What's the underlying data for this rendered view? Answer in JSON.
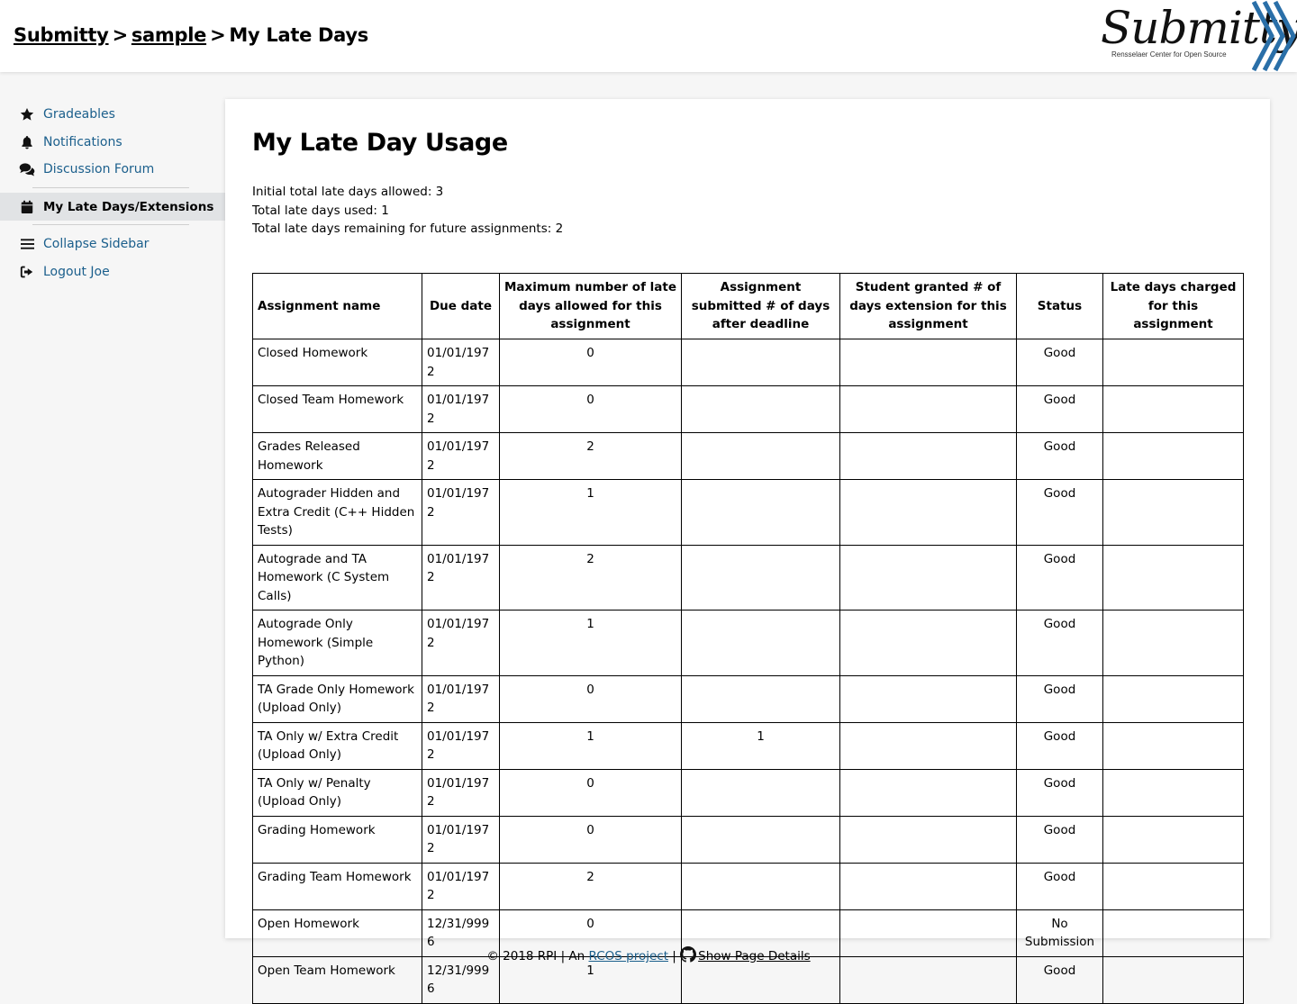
{
  "breadcrumb": {
    "home": "Submitty",
    "course": "sample",
    "page": "My Late Days",
    "separator": ">"
  },
  "logo": {
    "text": "Submitty",
    "subtitle": "Rensselaer Center for Open Source",
    "accent_color": "#2a6fa8"
  },
  "sidebar": {
    "items": [
      {
        "label": "Gradeables",
        "icon": "star-icon"
      },
      {
        "label": "Notifications",
        "icon": "bell-icon"
      },
      {
        "label": "Discussion Forum",
        "icon": "comments-icon"
      },
      {
        "label": "My Late Days/Extensions",
        "icon": "calendar-icon",
        "active": true
      },
      {
        "label": "Collapse Sidebar",
        "icon": "bars-icon"
      },
      {
        "label": "Logout Joe",
        "icon": "sign-out-icon"
      }
    ]
  },
  "main": {
    "title": "My Late Day Usage",
    "summary": {
      "allowed": "Initial total late days allowed: 3",
      "used": "Total late days used: 1",
      "remaining": "Total late days remaining for future assignments: 2"
    },
    "table": {
      "headers": [
        "Assignment name",
        "Due date",
        "Maximum number of late days allowed for this assignment",
        "Assignment submitted # of days after deadline",
        "Student granted # of days extension for this assignment",
        "Status",
        "Late days charged for this assignment"
      ],
      "rows": [
        {
          "name": "Closed Homework",
          "due": "01/01/1972",
          "max": "0",
          "submitted": "",
          "extension": "",
          "status": "Good",
          "charged": ""
        },
        {
          "name": "Closed Team Homework",
          "due": "01/01/1972",
          "max": "0",
          "submitted": "",
          "extension": "",
          "status": "Good",
          "charged": ""
        },
        {
          "name": "Grades Released Homework",
          "due": "01/01/1972",
          "max": "2",
          "submitted": "",
          "extension": "",
          "status": "Good",
          "charged": ""
        },
        {
          "name": "Autograder Hidden and Extra Credit (C++ Hidden Tests)",
          "due": "01/01/1972",
          "max": "1",
          "submitted": "",
          "extension": "",
          "status": "Good",
          "charged": ""
        },
        {
          "name": "Autograde and TA Homework (C System Calls)",
          "due": "01/01/1972",
          "max": "2",
          "submitted": "",
          "extension": "",
          "status": "Good",
          "charged": ""
        },
        {
          "name": "Autograde Only Homework (Simple Python)",
          "due": "01/01/1972",
          "max": "1",
          "submitted": "",
          "extension": "",
          "status": "Good",
          "charged": ""
        },
        {
          "name": "TA Grade Only Homework (Upload Only)",
          "due": "01/01/1972",
          "max": "0",
          "submitted": "",
          "extension": "",
          "status": "Good",
          "charged": ""
        },
        {
          "name": "TA Only w/ Extra Credit (Upload Only)",
          "due": "01/01/1972",
          "max": "1",
          "submitted": "1",
          "extension": "",
          "status": "Good",
          "charged": ""
        },
        {
          "name": "TA Only w/ Penalty (Upload Only)",
          "due": "01/01/1972",
          "max": "0",
          "submitted": "",
          "extension": "",
          "status": "Good",
          "charged": ""
        },
        {
          "name": "Grading Homework",
          "due": "01/01/1972",
          "max": "0",
          "submitted": "",
          "extension": "",
          "status": "Good",
          "charged": ""
        },
        {
          "name": "Grading Team Homework",
          "due": "01/01/1972",
          "max": "2",
          "submitted": "",
          "extension": "",
          "status": "Good",
          "charged": ""
        },
        {
          "name": "Open Homework",
          "due": "12/31/9996",
          "max": "0",
          "submitted": "",
          "extension": "",
          "status": "No Submission",
          "charged": ""
        },
        {
          "name": "Open Team Homework",
          "due": "12/31/9996",
          "max": "1",
          "submitted": "",
          "extension": "",
          "status": "Good",
          "charged": ""
        }
      ]
    }
  },
  "footer": {
    "copyright": "© 2018 RPI | An",
    "rcos_link": "RCOS project",
    "divider": "|",
    "details_link": "Show Page Details",
    "github_icon": "github-icon"
  },
  "colors": {
    "link": "#1b5f8c",
    "active_bg": "#e1e3e5",
    "page_bg": "#f6f6f6"
  }
}
